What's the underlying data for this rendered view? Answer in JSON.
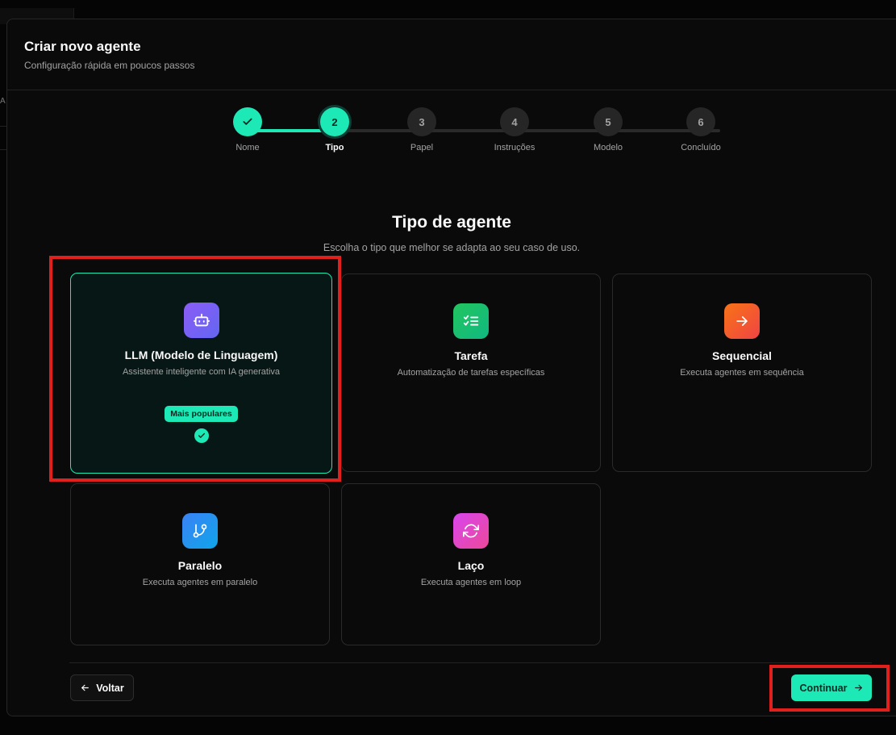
{
  "dialog": {
    "title": "Criar novo agente",
    "subtitle": "Configuração rápida em poucos passos"
  },
  "stepper": {
    "steps": [
      {
        "number": "1",
        "label": "Nome",
        "state": "done"
      },
      {
        "number": "2",
        "label": "Tipo",
        "state": "active"
      },
      {
        "number": "3",
        "label": "Papel",
        "state": "pending"
      },
      {
        "number": "4",
        "label": "Instruções",
        "state": "pending"
      },
      {
        "number": "5",
        "label": "Modelo",
        "state": "pending"
      },
      {
        "number": "6",
        "label": "Concluído",
        "state": "pending"
      }
    ]
  },
  "section": {
    "title": "Tipo de agente",
    "subtitle": "Escolha o tipo que melhor se adapta ao seu caso de uso."
  },
  "agent_types": [
    {
      "title": "LLM (Modelo de Linguagem)",
      "description": "Assistente inteligente com IA generativa",
      "badge": "Mais populares",
      "icon": "robot-icon",
      "selected": true
    },
    {
      "title": "Tarefa",
      "description": "Automatização de tarefas específicas",
      "icon": "checklist-icon",
      "selected": false
    },
    {
      "title": "Sequencial",
      "description": "Executa agentes em sequência",
      "icon": "arrow-right-icon",
      "selected": false
    },
    {
      "title": "Paralelo",
      "description": "Executa agentes em paralelo",
      "icon": "git-branch-icon",
      "selected": false
    },
    {
      "title": "Laço",
      "description": "Executa agentes em loop",
      "icon": "refresh-icon",
      "selected": false
    }
  ],
  "footer": {
    "back_label": "Voltar",
    "continue_label": "Continuar"
  },
  "colors": {
    "accent": "#1de9b6",
    "background": "#0a0a0a",
    "highlight": "#e0201c"
  }
}
